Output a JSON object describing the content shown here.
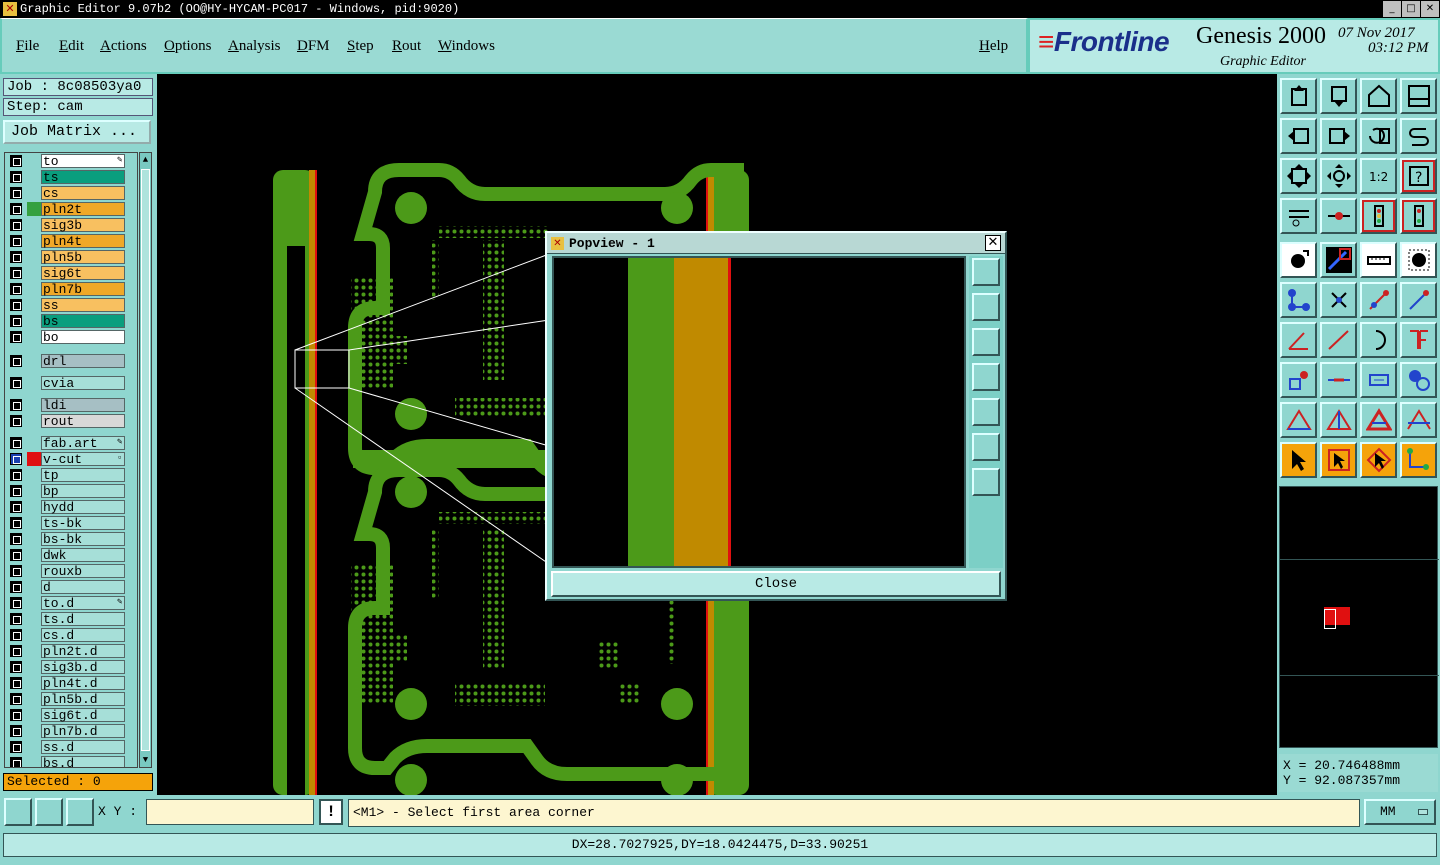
{
  "window": {
    "title": "Graphic Editor 9.07b2 (OO@HY-HYCAM-PC017 - Windows, pid:9020)",
    "app_icon": "x-app-icon"
  },
  "menu": {
    "items": [
      "File",
      "Edit",
      "Actions",
      "Options",
      "Analysis",
      "DFM",
      "Step",
      "Rout",
      "Windows"
    ],
    "help": "Help"
  },
  "brand": {
    "logo": "Frontline",
    "product": "Genesis 2000",
    "date": "07 Nov 2017",
    "time": "03:12 PM",
    "subtitle": "Graphic Editor"
  },
  "job": {
    "job_label": "Job : 8c08503ya0",
    "step_label": "Step: cam",
    "matrix_button": "Job Matrix ..."
  },
  "layers": [
    {
      "name": "to",
      "color": "#ffffff",
      "mark": "✎"
    },
    {
      "name": "ts",
      "color": "#0a9e7e"
    },
    {
      "name": "cs",
      "color": "#f8c060"
    },
    {
      "name": "pln2t",
      "color": "#f0a828",
      "active": "#35a040"
    },
    {
      "name": "sig3b",
      "color": "#f8c060"
    },
    {
      "name": "pln4t",
      "color": "#f0a828"
    },
    {
      "name": "pln5b",
      "color": "#f8c060"
    },
    {
      "name": "sig6t",
      "color": "#f8c060"
    },
    {
      "name": "pln7b",
      "color": "#f0a828"
    },
    {
      "name": "ss",
      "color": "#f8c060"
    },
    {
      "name": "bs",
      "color": "#0a9e7e"
    },
    {
      "name": "bo",
      "color": "#ffffff"
    },
    {
      "name": "drl",
      "color": "#a6bfc4"
    },
    {
      "name": "cvia",
      "color": "#a6dfd8"
    },
    {
      "name": "ldi",
      "color": "#a6bfc4"
    },
    {
      "name": "rout",
      "color": "#d8d8d8"
    },
    {
      "name": "fab.art",
      "color": "#a6dfd8",
      "mark": "✎"
    },
    {
      "name": "v-cut",
      "color": "#a6dfd8",
      "active": "#e01010",
      "mark": "▫"
    },
    {
      "name": "tp",
      "color": "#a6dfd8"
    },
    {
      "name": "bp",
      "color": "#a6dfd8"
    },
    {
      "name": "hydd",
      "color": "#a6dfd8"
    },
    {
      "name": "ts-bk",
      "color": "#a6dfd8"
    },
    {
      "name": "bs-bk",
      "color": "#a6dfd8"
    },
    {
      "name": "dwk",
      "color": "#a6dfd8"
    },
    {
      "name": "rouxb",
      "color": "#a6dfd8"
    },
    {
      "name": "d",
      "color": "#a6dfd8"
    },
    {
      "name": "to.d",
      "color": "#a6dfd8",
      "mark": "✎"
    },
    {
      "name": "ts.d",
      "color": "#a6dfd8"
    },
    {
      "name": "cs.d",
      "color": "#a6dfd8"
    },
    {
      "name": "pln2t.d",
      "color": "#a6dfd8"
    },
    {
      "name": "sig3b.d",
      "color": "#a6dfd8"
    },
    {
      "name": "pln4t.d",
      "color": "#a6dfd8"
    },
    {
      "name": "pln5b.d",
      "color": "#a6dfd8"
    },
    {
      "name": "sig6t.d",
      "color": "#a6dfd8"
    },
    {
      "name": "pln7b.d",
      "color": "#a6dfd8"
    },
    {
      "name": "ss.d",
      "color": "#a6dfd8"
    },
    {
      "name": "bs.d",
      "color": "#a6dfd8"
    }
  ],
  "selected": "Selected : 0",
  "popview": {
    "title": "Popview - 1",
    "close_button": "Close"
  },
  "coords": {
    "x": "X = 20.746488mm",
    "y": "Y = 92.087357mm"
  },
  "bottom": {
    "xy_label": "X Y :",
    "xy_value": "",
    "prompt": "<M1> - Select first area corner",
    "units": "MM"
  },
  "status": "DX=28.7027925,DY=18.0424475,D=33.90251",
  "colors": {
    "board_green": "#4c9a19",
    "copper_orange": "#c08a00",
    "edge_red": "#e01010",
    "panel_teal": "#8fd6cf"
  }
}
